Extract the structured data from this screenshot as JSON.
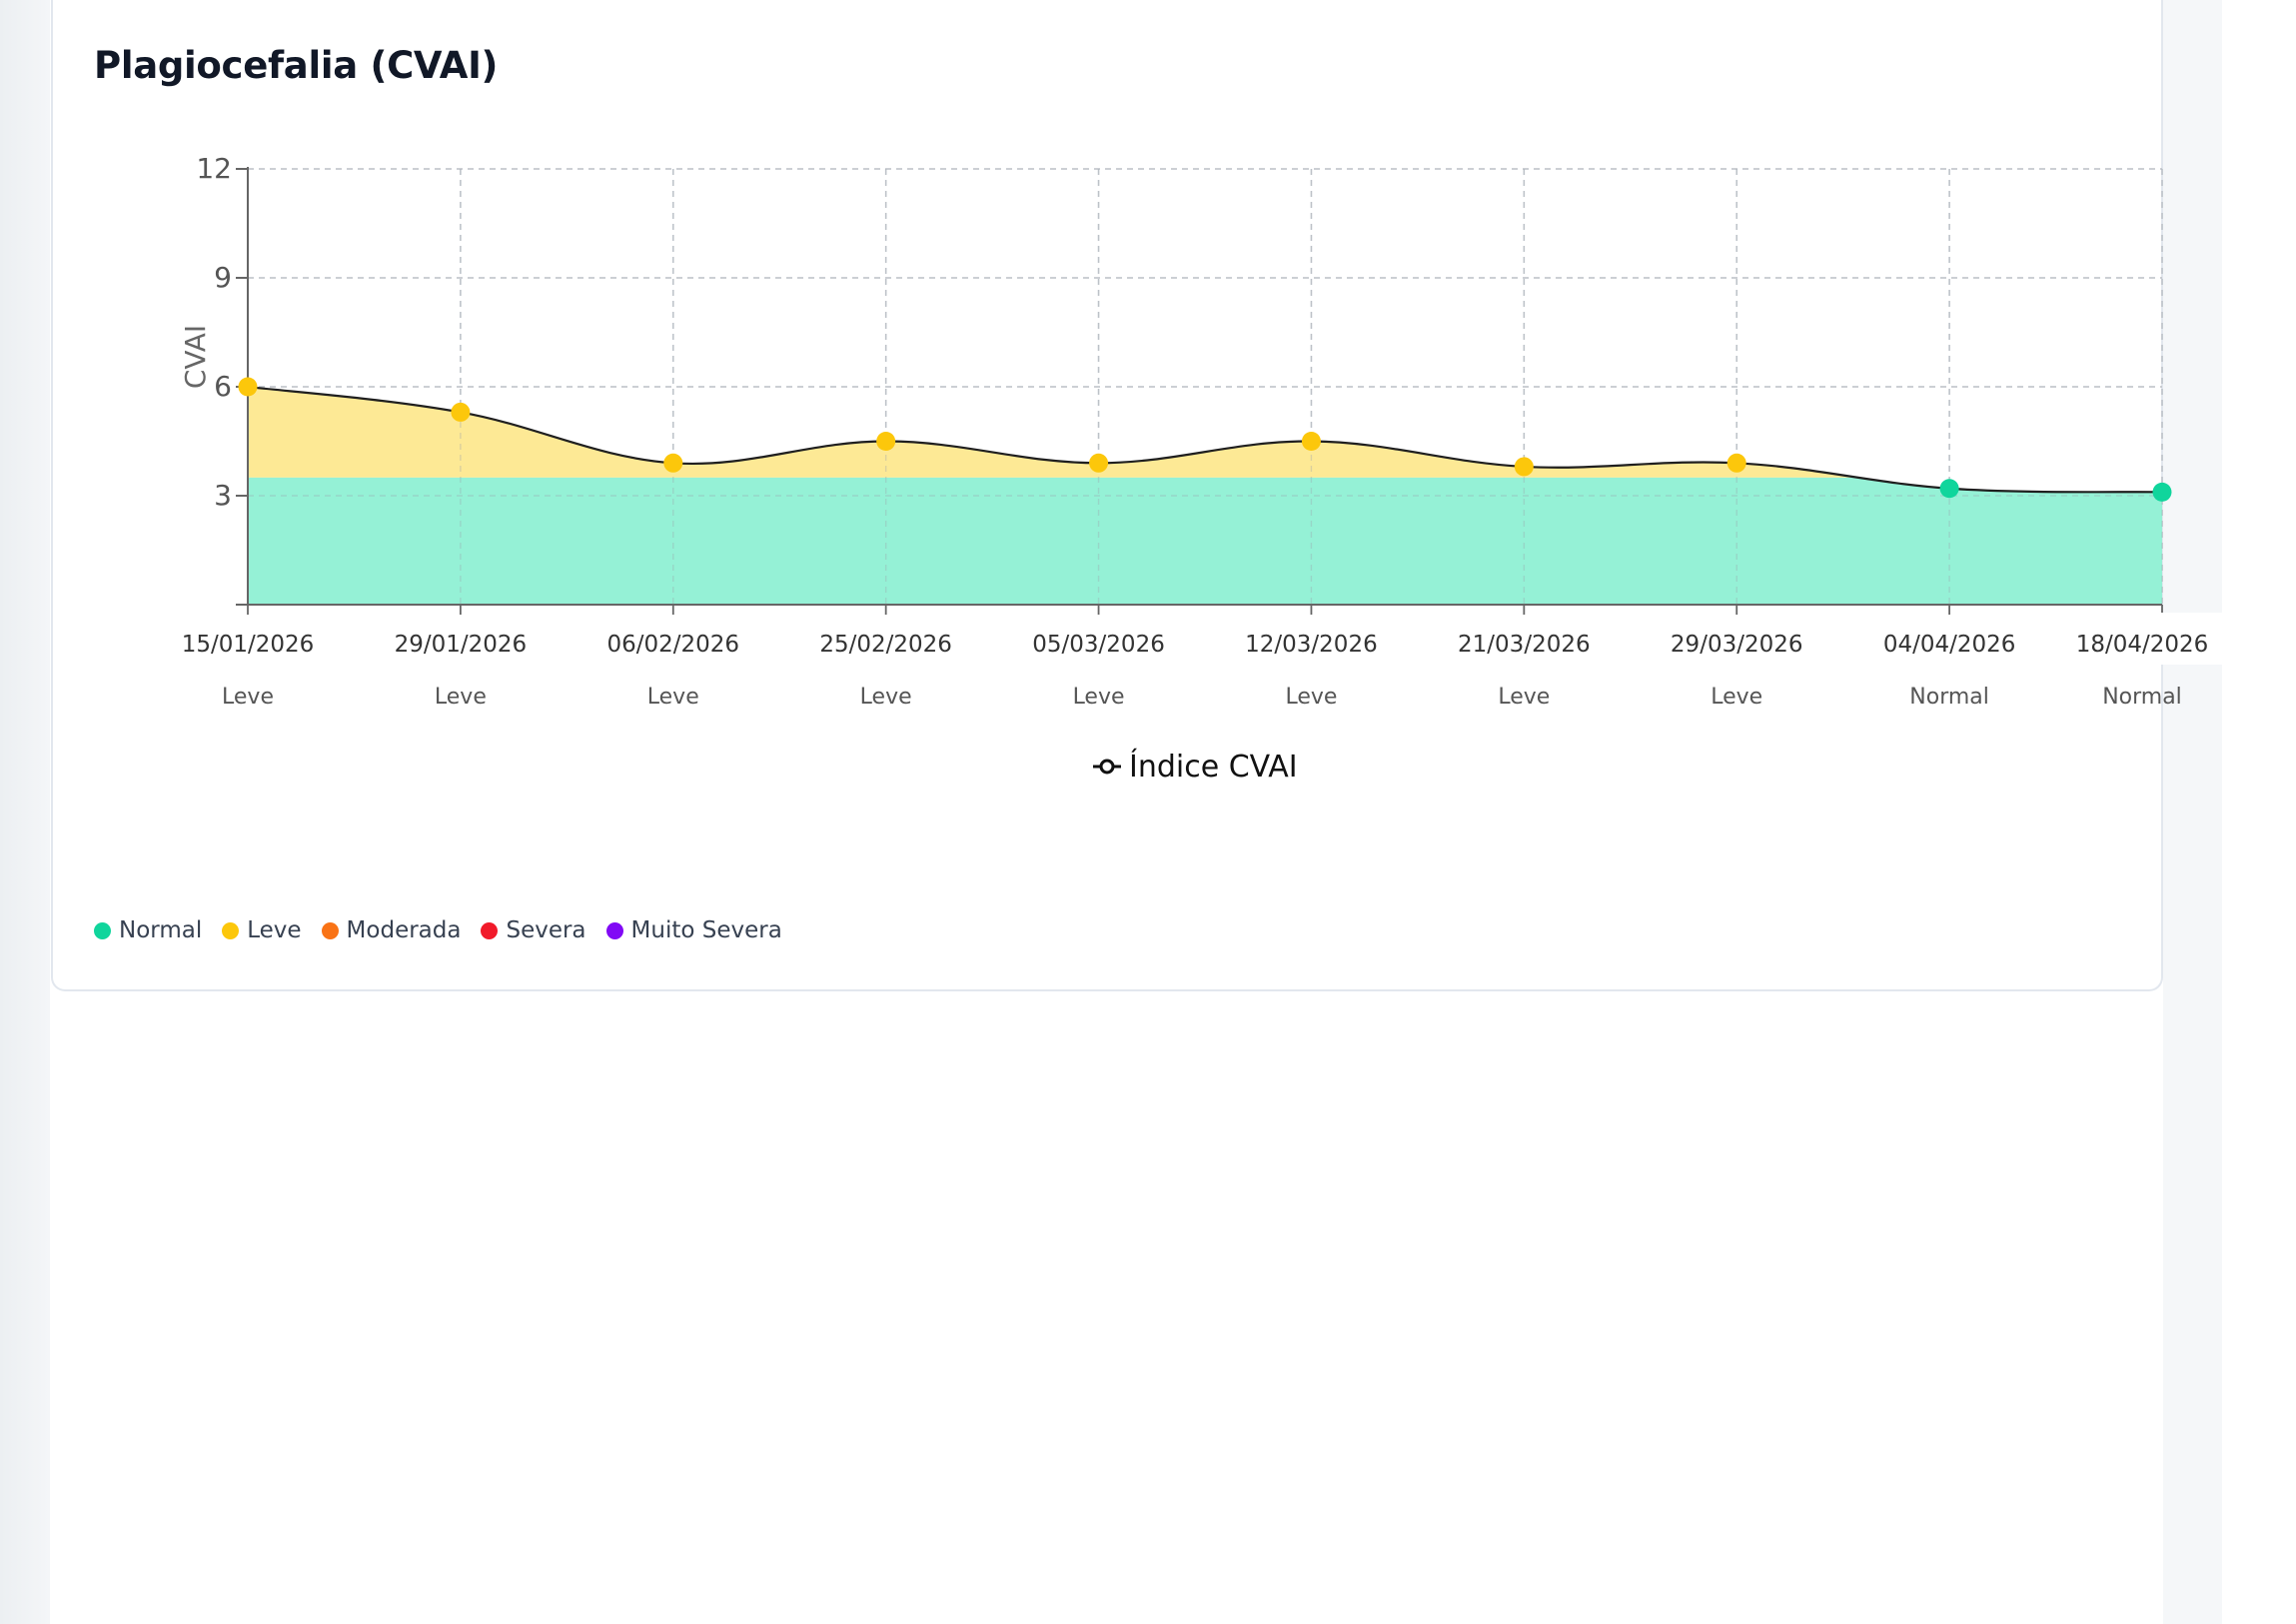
{
  "card": {
    "title": "Plagiocefalia (CVAI)"
  },
  "chart_data": {
    "type": "area",
    "title": "Plagiocefalia (CVAI)",
    "ylabel": "CVAI",
    "xlabel": "",
    "ylim": [
      0,
      12
    ],
    "yticks": [
      "3",
      "6",
      "9",
      "12"
    ],
    "grid": true,
    "curve": "smooth",
    "categories": [
      "15/01/2026",
      "29/01/2026",
      "06/02/2026",
      "25/02/2026",
      "05/03/2026",
      "12/03/2026",
      "21/03/2026",
      "29/03/2026",
      "04/04/2026",
      "18/04/2026"
    ],
    "sublabels": [
      "Leve",
      "Leve",
      "Leve",
      "Leve",
      "Leve",
      "Leve",
      "Leve",
      "Leve",
      "Normal",
      "Normal"
    ],
    "series": [
      {
        "name": "Índice CVAI",
        "values": [
          6.0,
          5.3,
          3.9,
          4.5,
          3.9,
          4.5,
          3.8,
          3.9,
          3.2,
          3.1
        ]
      }
    ],
    "normal_threshold": 3.5,
    "colors": {
      "normal_fill": "#95f1d6",
      "leve_fill": "#fde995",
      "line": "#1f1f1f"
    }
  },
  "legend": {
    "series_label": "Índice CVAI",
    "status_items": [
      {
        "label": "Normal",
        "color": "#10d59c"
      },
      {
        "label": "Leve",
        "color": "#fcc70b"
      },
      {
        "label": "Moderada",
        "color": "#f97316"
      },
      {
        "label": "Severa",
        "color": "#f11a2a"
      },
      {
        "label": "Muito Severa",
        "color": "#8109f5"
      }
    ]
  }
}
